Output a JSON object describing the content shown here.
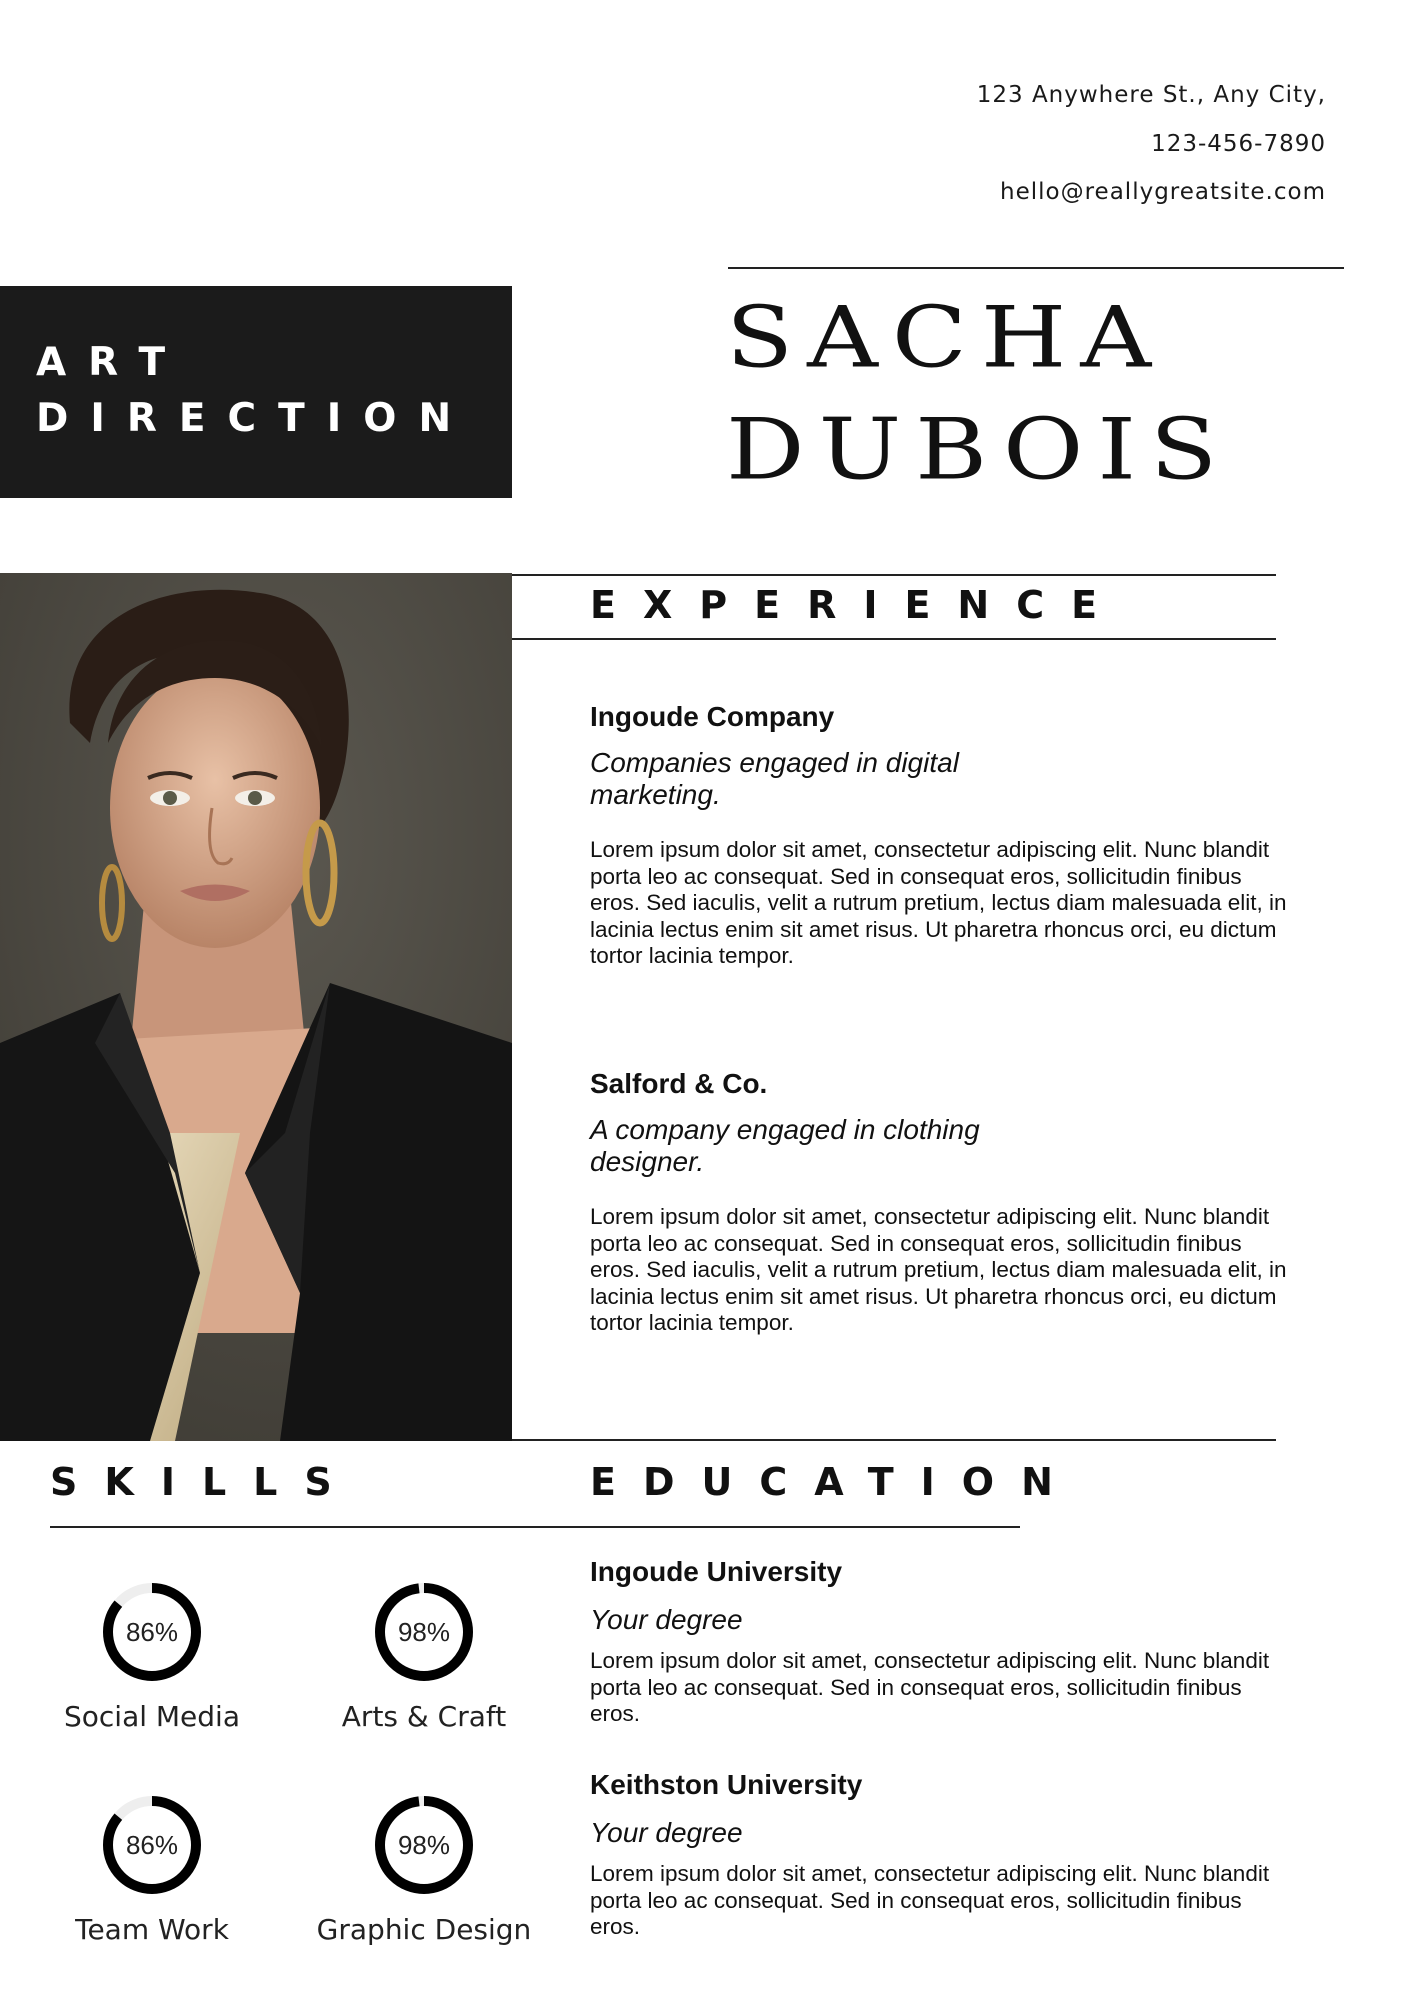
{
  "contact": {
    "address": "123 Anywhere St., Any City,",
    "phone": "123-456-7890",
    "email": "hello@reallygreatsite.com"
  },
  "role": {
    "line1": "ART",
    "line2": "DIRECTION"
  },
  "name": {
    "first": "SACHA",
    "last": "DUBOIS"
  },
  "experience": {
    "title": "EXPERIENCE",
    "items": [
      {
        "company": "Ingoude Company",
        "description": "Companies engaged in digital marketing.",
        "body": "Lorem ipsum dolor sit amet, consectetur adipiscing elit. Nunc blandit porta leo ac consequat. Sed in consequat eros, sollicitudin finibus eros. Sed iaculis, velit a rutrum pretium, lectus diam malesuada elit, in lacinia lectus enim sit amet risus. Ut pharetra rhoncus orci, eu dictum tortor lacinia tempor."
      },
      {
        "company": "Salford & Co.",
        "description": "A company engaged in clothing designer.",
        "body": "Lorem ipsum dolor sit amet, consectetur adipiscing elit. Nunc blandit porta leo ac consequat. Sed in consequat eros, sollicitudin finibus eros. Sed iaculis, velit a rutrum pretium, lectus diam malesuada elit, in lacinia lectus enim sit amet risus. Ut pharetra rhoncus orci, eu dictum tortor lacinia tempor."
      }
    ]
  },
  "skills": {
    "title": "SKILLS",
    "items": [
      {
        "label": "Social Media",
        "value": "86%",
        "fraction": 0.86
      },
      {
        "label": "Arts & Craft",
        "value": "98%",
        "fraction": 0.98
      },
      {
        "label": "Team Work",
        "value": "86%",
        "fraction": 0.86
      },
      {
        "label": "Graphic Design",
        "value": "98%",
        "fraction": 0.98
      }
    ]
  },
  "education": {
    "title": "EDUCATION",
    "items": [
      {
        "school": "Ingoude University",
        "degree": "Your degree",
        "body": "Lorem ipsum dolor sit amet, consectetur adipiscing elit. Nunc blandit porta leo ac consequat. Sed in consequat eros, sollicitudin finibus eros."
      },
      {
        "school": "Keithston University",
        "degree": "Your degree",
        "body": "Lorem ipsum dolor sit amet, consectetur adipiscing elit. Nunc blandit porta leo ac consequat. Sed in consequat eros, sollicitudin finibus eros."
      }
    ]
  },
  "colors": {
    "role_block_bg": "#1b1b1b",
    "text": "#111111",
    "gauge_fill": "#000000",
    "gauge_track": "#eeeeee",
    "portrait_background": "#4e4b43"
  }
}
